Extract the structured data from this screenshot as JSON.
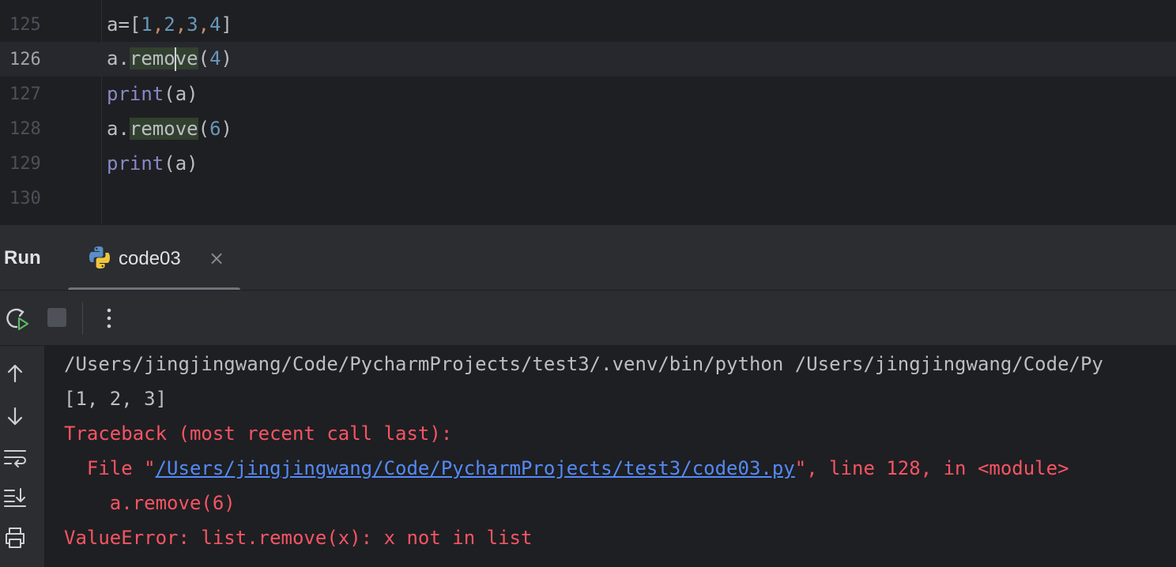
{
  "editor": {
    "lines": [
      {
        "number": "125",
        "code": "a=[1,2,3,4]"
      },
      {
        "number": "126",
        "code": "a.remove(4)"
      },
      {
        "number": "127",
        "code": "print(a)"
      },
      {
        "number": "128",
        "code": "a.remove(6)"
      },
      {
        "number": "129",
        "code": "print(a)"
      },
      {
        "number": "130",
        "code": ""
      }
    ],
    "current_line": "126"
  },
  "run_panel": {
    "title": "Run",
    "tab_label": "code03",
    "tab_icon": "python-icon",
    "close_glyph": "×"
  },
  "toolbar": {
    "icons": [
      "rerun-icon",
      "stop-icon",
      "more-options-icon"
    ]
  },
  "side_icons": [
    "scroll-up-icon",
    "scroll-down-icon",
    "soft-wrap-icon",
    "scroll-to-end-icon",
    "print-icon"
  ],
  "console": {
    "cmd_line": "/Users/jingjingwang/Code/PycharmProjects/test3/.venv/bin/python /Users/jingjingwang/Code/Py",
    "output_line": "[1, 2, 3]",
    "traceback_header": "Traceback (most recent call last):",
    "file_prefix": "  File \"",
    "file_path": "/Users/jingjingwang/Code/PycharmProjects/test3/code03.py",
    "file_suffix": "\", line 128, in <module>",
    "code_line": "    a.remove(6)",
    "error_line": "ValueError: list.remove(x): x not in list"
  },
  "colors": {
    "background": "#1e1f22",
    "panel": "#2b2d30",
    "error_text": "#f75464",
    "link": "#548af7",
    "keyword_builtin": "#8888c6",
    "number": "#2aacb8"
  }
}
